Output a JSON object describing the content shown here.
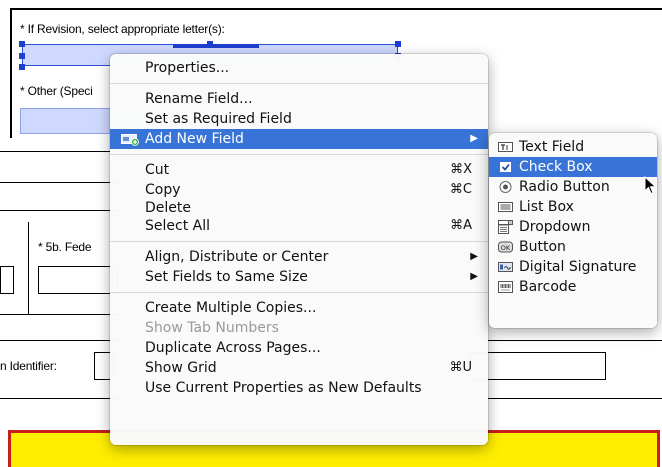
{
  "form": {
    "revision_label": "* If Revision, select appropriate letter(s):",
    "other_label": "* Other (Speci",
    "federal_label": "* 5b. Fede",
    "identifier_label": "n Identifier:"
  },
  "context_menu": {
    "items": [
      {
        "label": "Properties..."
      },
      {
        "label": "Rename Field..."
      },
      {
        "label": "Set as Required Field"
      },
      {
        "label": "Add New Field"
      },
      {
        "label": "Cut",
        "shortcut": "⌘X"
      },
      {
        "label": "Copy",
        "shortcut": "⌘C"
      },
      {
        "label": "Delete"
      },
      {
        "label": "Select All",
        "shortcut": "⌘A"
      },
      {
        "label": "Align, Distribute or Center"
      },
      {
        "label": "Set Fields to Same Size"
      },
      {
        "label": "Create Multiple Copies..."
      },
      {
        "label": "Show Tab Numbers"
      },
      {
        "label": "Duplicate Across Pages..."
      },
      {
        "label": "Show Grid",
        "shortcut": "⌘U"
      },
      {
        "label": "Use Current Properties as New Defaults"
      }
    ],
    "highlighted": "Add New Field",
    "disabled": [
      "Show Tab Numbers"
    ]
  },
  "submenu": {
    "items": [
      {
        "label": "Text Field",
        "icon": "text-field-icon"
      },
      {
        "label": "Check Box",
        "icon": "checkbox-icon"
      },
      {
        "label": "Radio Button",
        "icon": "radio-button-icon"
      },
      {
        "label": "List Box",
        "icon": "list-box-icon"
      },
      {
        "label": "Dropdown",
        "icon": "dropdown-icon"
      },
      {
        "label": "Button",
        "icon": "ok-button-icon"
      },
      {
        "label": "Digital Signature",
        "icon": "digital-signature-icon"
      },
      {
        "label": "Barcode",
        "icon": "barcode-icon"
      }
    ],
    "highlighted": "Check Box"
  },
  "colors": {
    "menu_highlight": "#3874d8",
    "field_fill": "#cfd9ff",
    "banner_fill": "#ffee00",
    "banner_border": "#c81e1e"
  }
}
